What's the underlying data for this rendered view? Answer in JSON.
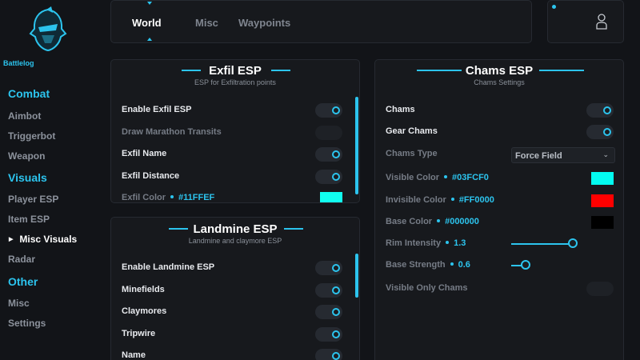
{
  "sidebar": {
    "brand": "Battlelog",
    "sections": [
      {
        "title": "Combat",
        "items": [
          "Aimbot",
          "Triggerbot",
          "Weapon"
        ]
      },
      {
        "title": "Visuals",
        "items": [
          "Player ESP",
          "Item ESP",
          "Misc Visuals",
          "Radar"
        ]
      },
      {
        "title": "Other",
        "items": [
          "Misc",
          "Settings"
        ]
      }
    ]
  },
  "tabs": [
    "World",
    "Misc",
    "Waypoints"
  ],
  "exfil": {
    "title": "Exfil ESP",
    "subtitle": "ESP for Exfiltration points",
    "rows": [
      {
        "label": "Enable Exfil ESP",
        "on": true
      },
      {
        "label": "Draw Marathon Transits",
        "on": false
      },
      {
        "label": "Exfil Name",
        "on": true
      },
      {
        "label": "Exfil Distance",
        "on": true
      },
      {
        "label": "Exfil Color",
        "hex": "#11FFEF",
        "color": "#11FFEF"
      }
    ]
  },
  "landmine": {
    "title": "Landmine ESP",
    "subtitle": "Landmine and claymore ESP",
    "rows": [
      {
        "label": "Enable Landmine ESP",
        "on": true
      },
      {
        "label": "Minefields",
        "on": true
      },
      {
        "label": "Claymores",
        "on": true
      },
      {
        "label": "Tripwire",
        "on": true
      },
      {
        "label": "Name",
        "on": true
      }
    ]
  },
  "chams": {
    "title": "Chams ESP",
    "subtitle": "Chams Settings",
    "chams": {
      "label": "Chams",
      "on": true
    },
    "gear_chams": {
      "label": "Gear Chams",
      "on": true
    },
    "type": {
      "label": "Chams Type",
      "value": "Force Field"
    },
    "visible_color": {
      "label": "Visible Color",
      "hex": "#03FCF0",
      "color": "#03FCF0"
    },
    "invisible_color": {
      "label": "Invisible Color",
      "hex": "#FF0000",
      "color": "#FF0000"
    },
    "base_color": {
      "label": "Base Color",
      "hex": "#000000",
      "color": "#000000"
    },
    "rim_intensity": {
      "label": "Rim Intensity",
      "value": "1.3",
      "fraction": 0.87
    },
    "base_strength": {
      "label": "Base Strength",
      "value": "0.6",
      "fraction": 0.2
    },
    "visible_only": {
      "label": "Visible Only Chams",
      "on": false
    }
  },
  "colors": {
    "accent": "#2cc4ee",
    "background": "#121418",
    "panel": "#17191d"
  }
}
